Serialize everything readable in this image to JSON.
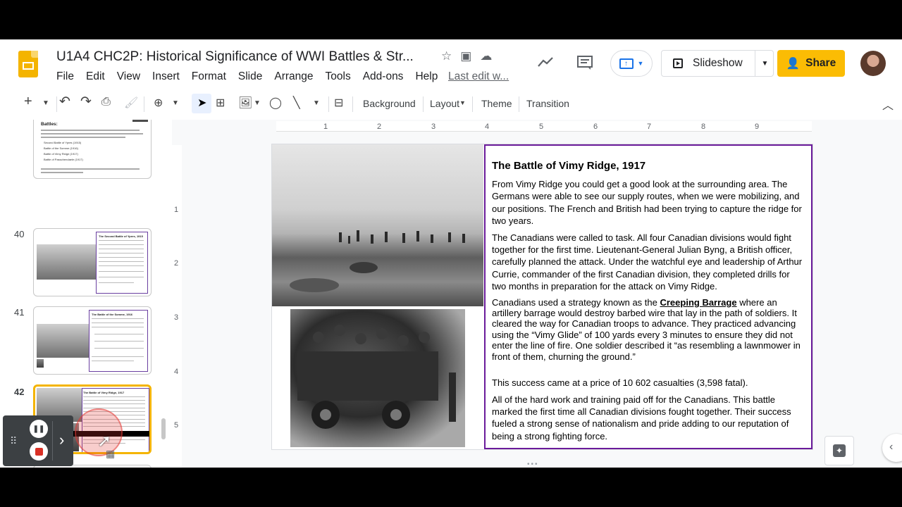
{
  "header": {
    "doc_title": "U1A4 CHC2P: Historical Significance of WWI Battles & Str...",
    "menu": [
      "File",
      "Edit",
      "View",
      "Insert",
      "Format",
      "Slide",
      "Arrange",
      "Tools",
      "Add-ons",
      "Help"
    ],
    "last_edit": "Last edit w...",
    "slideshow_label": "Slideshow",
    "share_label": "Share"
  },
  "toolbar": {
    "background_label": "Background",
    "layout_label": "Layout",
    "theme_label": "Theme",
    "transition_label": "Transition"
  },
  "rulers": {
    "top_ticks": [
      "1",
      "2",
      "3",
      "4",
      "5",
      "6",
      "7",
      "8",
      "9"
    ],
    "left_ticks": [
      "1",
      "2",
      "3",
      "4",
      "5"
    ]
  },
  "filmstrip": {
    "slides": [
      {
        "number": "",
        "title": "Battles:",
        "selected": false
      },
      {
        "number": "40",
        "title": "The Second Battle of Ypres, 1915",
        "selected": false
      },
      {
        "number": "41",
        "title": "The Battle of the Somme, 1916",
        "selected": false
      },
      {
        "number": "42",
        "title": "The Battle of Vimy Ridge, 1917",
        "selected": true
      }
    ],
    "slide_1_list": [
      "Second Battle of Ypres (1915)",
      "Battle of the Somme (1916)",
      "Battle of Vimy Ridge (1917)",
      "Battle of Passchendaele (1917)"
    ]
  },
  "slide": {
    "title": "The Battle of Vimy Ridge, 1917",
    "p1": "From Vimy Ridge you could get a good look at the surrounding area. The Germans were able to see our supply routes, when we were mobilizing, and our positions. The French and British had been trying to capture the ridge for two years.",
    "p2": "The Canadians were called to task. All four Canadian divisions would fight together for the first time. Lieutenant-General Julian Byng, a British officer, carefully planned the attack. Under the watchful eye and leadership of Arthur Currie, commander of the first Canadian division, they completed drills for two months in preparation for the attack on Vimy Ridge.",
    "p3_before": "Canadians used a strategy known as the ",
    "p3_bold": "Creeping Barrage",
    "p3_after": " where an artillery barrage would destroy barbed wire that lay in the path of soldiers. It cleared the way for Canadian troops to advance. They practiced advancing using the “Vimy Glide” of 100 yards every 3 minutes to ensure they did not enter the line of fire. One soldier described it “as resembling a lawnmower in front of them, churning the ground.”",
    "p4": "This success came at a price of 10 602 casualties (3,598 fatal).",
    "p5": "All of the hard work and training paid off for the Canadians. This battle marked the first time all Canadian divisions fought together. Their success fueled a strong sense of nationalism and pride adding to our reputation of being a strong fighting force."
  },
  "colors": {
    "share": "#fbbc04",
    "textbox_border": "#6a1b9a",
    "selected_thumb": "#f4b400",
    "accent_blue": "#1a73e8"
  }
}
